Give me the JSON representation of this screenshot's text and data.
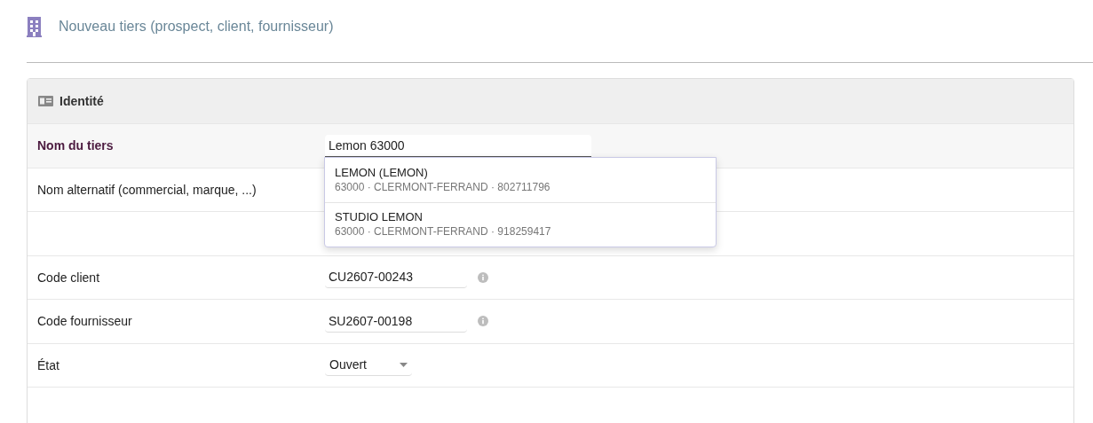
{
  "page_title": "Nouveau tiers (prospect, client, fournisseur)",
  "section": {
    "title": "Identité"
  },
  "rows": [
    {
      "kind": "autocomplete",
      "label": "Nom du tiers",
      "required": true,
      "value": "Lemon 63000",
      "suggestions": [
        {
          "name": "LEMON (LEMON)",
          "detail": "63000 · CLERMONT-FERRAND · 802711796"
        },
        {
          "name": "STUDIO LEMON",
          "detail": "63000 · CLERMONT-FERRAND · 918259417"
        }
      ]
    },
    {
      "kind": "blank",
      "label": "Nom alternatif (commercial, marque, ...)",
      "required": false
    },
    {
      "kind": "blank"
    },
    {
      "kind": "code",
      "label": "Code client",
      "required": false,
      "value": "CU2607-00243"
    },
    {
      "kind": "code",
      "label": "Code fournisseur",
      "required": false,
      "value": "SU2607-00198"
    },
    {
      "kind": "select",
      "label": "État",
      "required": false,
      "value": "Ouvert"
    }
  ]
}
